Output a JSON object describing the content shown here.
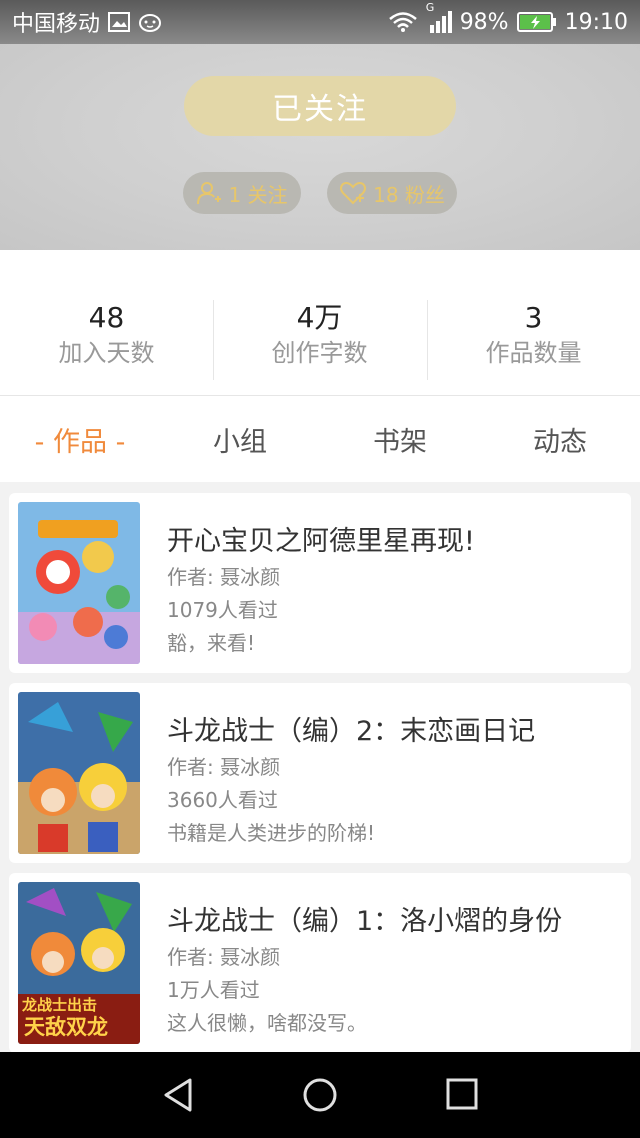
{
  "status_bar": {
    "carrier": "中国移动",
    "battery": "98%",
    "time": "19:10",
    "network": "G",
    "icons": [
      "image-icon",
      "cat-icon",
      "wifi-icon",
      "signal-icon",
      "battery-charging-icon"
    ]
  },
  "header": {
    "follow_button": "已关注",
    "following": "1 关注",
    "fans": "18 粉丝",
    "colors": {
      "button_bg": "#e3d7a8",
      "pill_text": "#e7c66a"
    }
  },
  "stats": [
    {
      "value": "48",
      "label": "加入天数"
    },
    {
      "value": "4万",
      "label": "创作字数"
    },
    {
      "value": "3",
      "label": "作品数量"
    }
  ],
  "tabs": [
    {
      "label": "- 作品 -",
      "active": true
    },
    {
      "label": "小组",
      "active": false
    },
    {
      "label": "书架",
      "active": false
    },
    {
      "label": "动态",
      "active": false
    }
  ],
  "accent_color": "#f08a3c",
  "works": [
    {
      "title": "开心宝贝之阿德里星再现!",
      "author": "作者: 聂冰颜",
      "views": "1079人看过",
      "desc": "豁，来看!"
    },
    {
      "title": "斗龙战士（编）2：末恋画日记",
      "author": "作者: 聂冰颜",
      "views": "3660人看过",
      "desc": "书籍是人类进步的阶梯!"
    },
    {
      "title": "斗龙战士（编）1：洛小熠的身份",
      "author": "作者: 聂冰颜",
      "views": "1万人看过",
      "desc": "这人很懒，啥都没写。",
      "cover_text": [
        "龙战士出击",
        "天敌双龙"
      ]
    }
  ],
  "nav": [
    "back-icon",
    "home-icon",
    "recents-icon"
  ]
}
